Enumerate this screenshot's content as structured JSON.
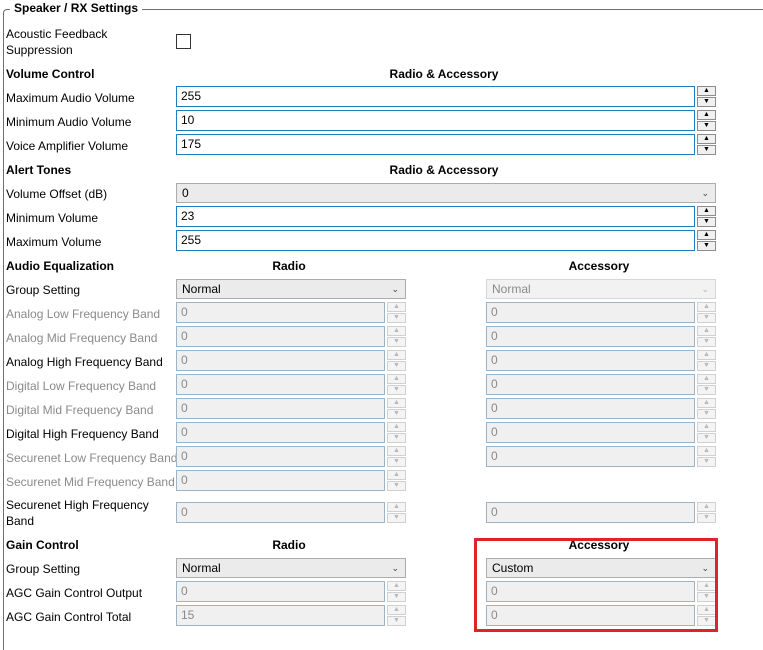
{
  "section_title": "Speaker / RX Settings",
  "afs": {
    "label": "Acoustic Feedback Suppression",
    "checked": false
  },
  "volume_control": {
    "title": "Volume Control",
    "column": "Radio & Accessory",
    "rows": [
      {
        "label": "Maximum Audio Volume",
        "value": "255"
      },
      {
        "label": "Minimum Audio Volume",
        "value": "10"
      },
      {
        "label": "Voice Amplifier Volume",
        "value": "175"
      }
    ]
  },
  "alert_tones": {
    "title": "Alert Tones",
    "column": "Radio & Accessory",
    "offset": {
      "label": "Volume Offset (dB)",
      "value": "0"
    },
    "rows": [
      {
        "label": "Minimum Volume",
        "value": "23"
      },
      {
        "label": "Maximum Volume",
        "value": "255"
      }
    ]
  },
  "equalization": {
    "title": "Audio Equalization",
    "col_radio": "Radio",
    "col_accessory": "Accessory",
    "group": {
      "label": "Group Setting",
      "radio": "Normal",
      "accessory": "Normal"
    },
    "rows": [
      {
        "label": "Analog Low Frequency Band",
        "radio": "0",
        "accessory": "0",
        "enabled": false
      },
      {
        "label": "Analog Mid Frequency Band",
        "radio": "0",
        "accessory": "0",
        "enabled": false
      },
      {
        "label": "Analog High Frequency Band",
        "radio": "0",
        "accessory": "0",
        "enabled": true
      },
      {
        "label": "Digital Low Frequency Band",
        "radio": "0",
        "accessory": "0",
        "enabled": false
      },
      {
        "label": "Digital Mid Frequency Band",
        "radio": "0",
        "accessory": "0",
        "enabled": false
      },
      {
        "label": "Digital High Frequency Band",
        "radio": "0",
        "accessory": "0",
        "enabled": true
      },
      {
        "label": "Securenet Low Frequency Band",
        "radio": "0",
        "accessory": "0",
        "enabled": false
      },
      {
        "label": "Securenet Mid Frequency Band",
        "radio": "0",
        "enabled": false
      },
      {
        "label": "Securenet High Frequency Band",
        "radio": "0",
        "accessory": "0",
        "enabled": true
      }
    ]
  },
  "gain_control": {
    "title": "Gain Control",
    "col_radio": "Radio",
    "col_accessory": "Accessory",
    "group": {
      "label": "Group Setting",
      "radio": "Normal",
      "accessory": "Custom"
    },
    "rows": [
      {
        "label": "AGC Gain Control Output",
        "radio": "0",
        "accessory": "0"
      },
      {
        "label": "AGC Gain Control Total",
        "radio": "15",
        "accessory": "0"
      }
    ]
  },
  "icons": {
    "spin_up": "▲",
    "spin_down": "▼",
    "dropdown": "⌄"
  },
  "colors": {
    "highlight": "#e0232a",
    "focus_border": "#1f7ebf"
  }
}
